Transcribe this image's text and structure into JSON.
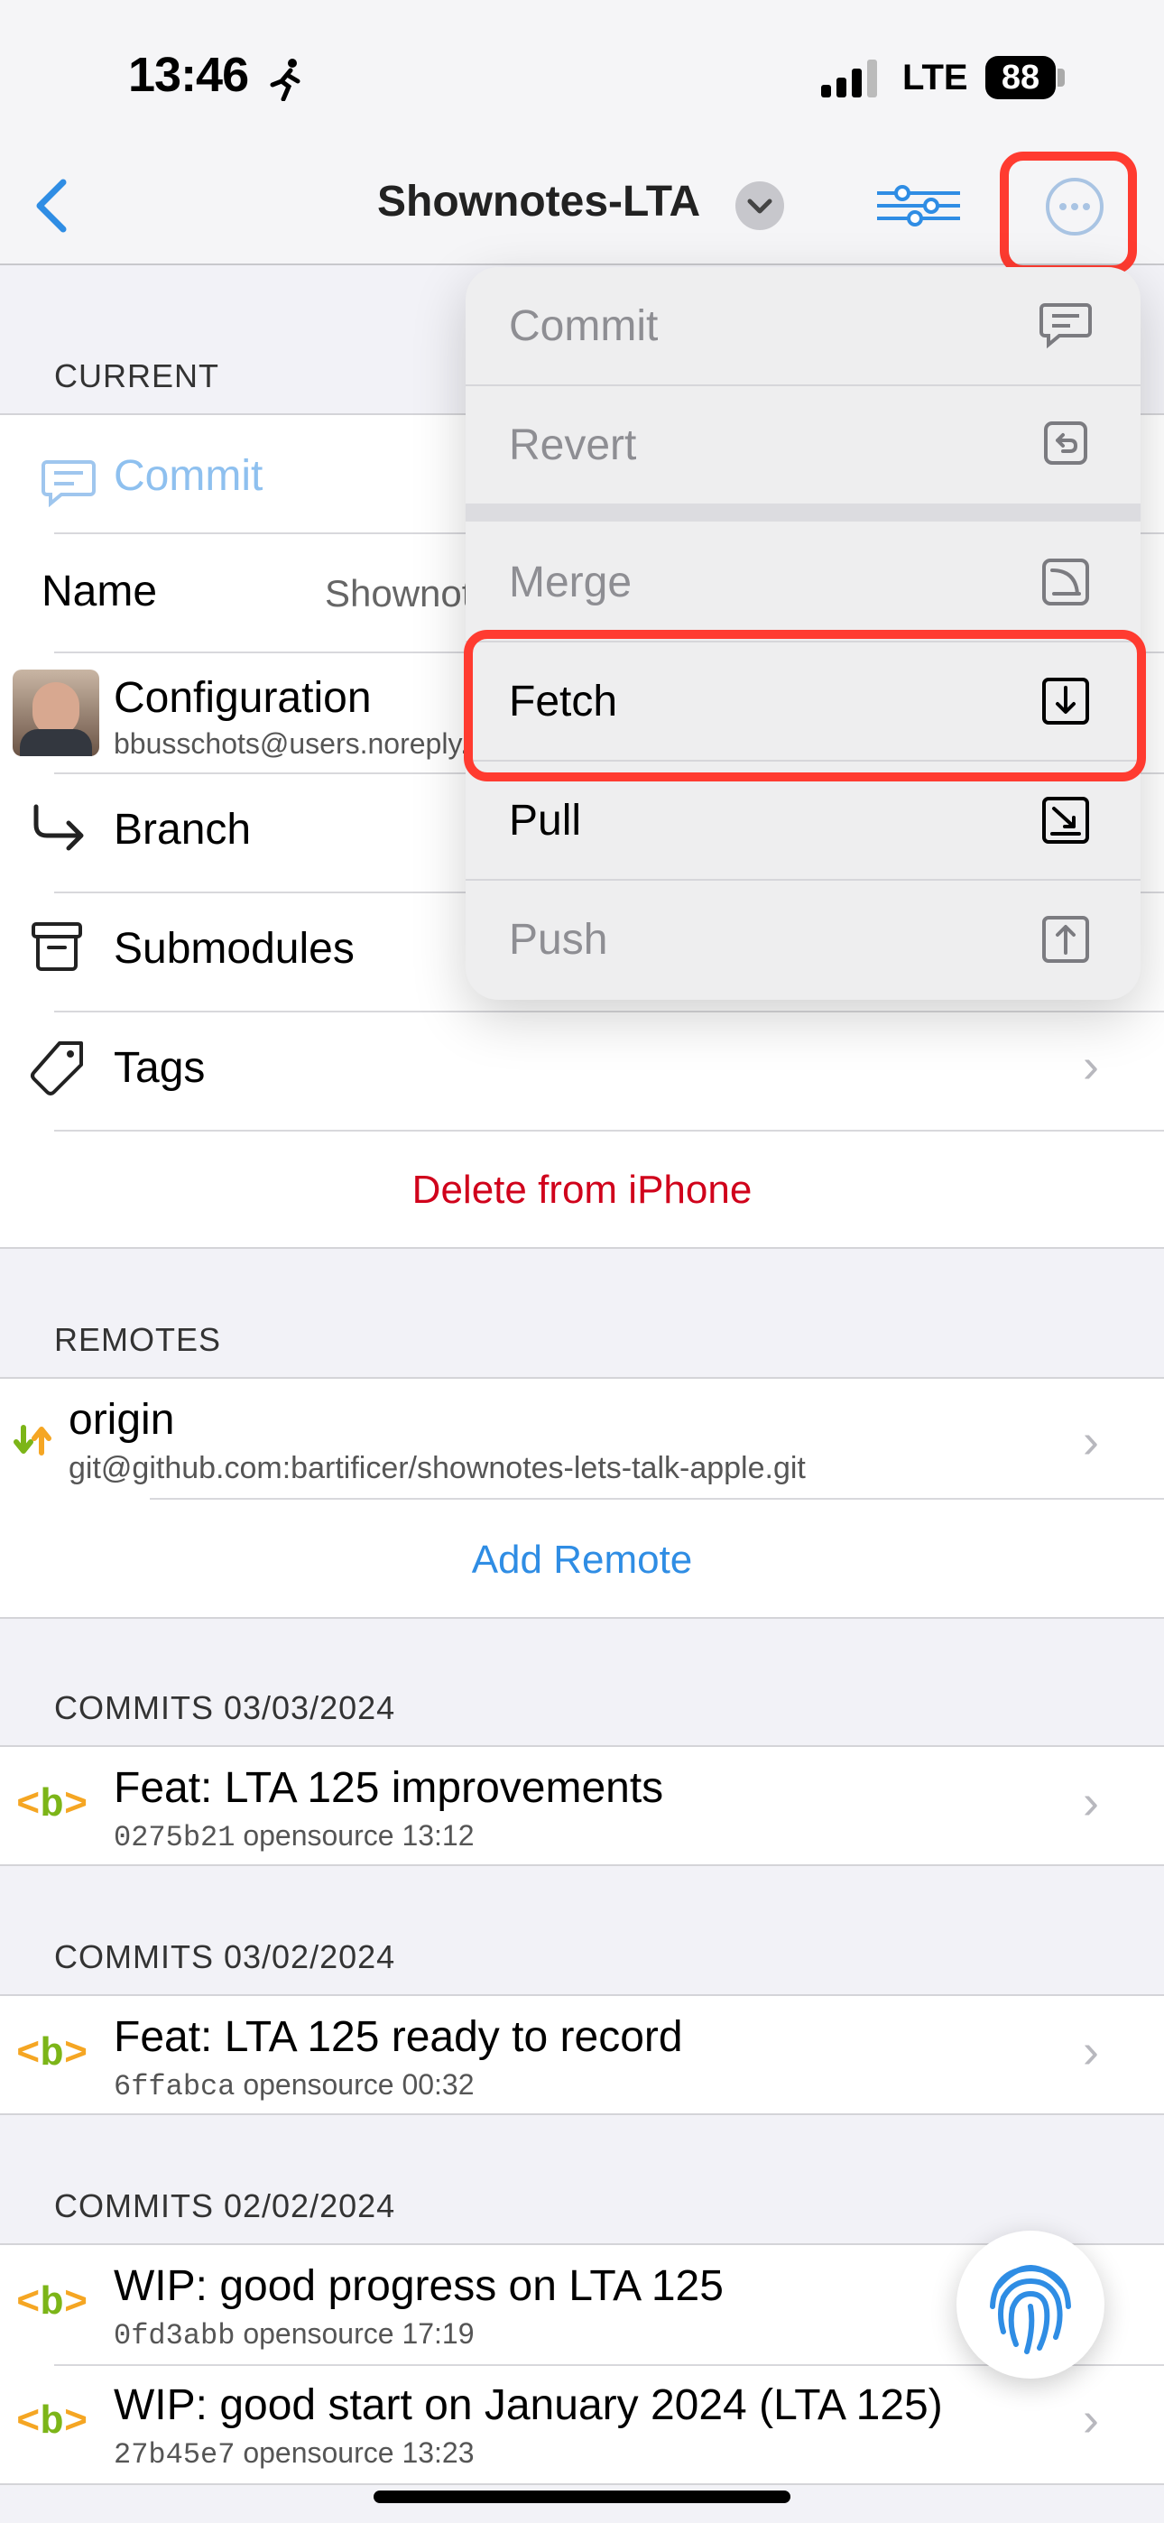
{
  "status_bar": {
    "time": "13:46",
    "network": "LTE",
    "battery": "88"
  },
  "nav": {
    "title": "Shownotes-LTA"
  },
  "current": {
    "header": "CURRENT",
    "commit_label": "Commit",
    "name_label": "Name",
    "name_value": "Shownotes-LTA",
    "config_label": "Configuration",
    "config_email": "bbusschots@users.noreply.github.com",
    "branch_label": "Branch",
    "submodules_label": "Submodules",
    "tags_label": "Tags",
    "delete_label": "Delete from iPhone"
  },
  "menu": {
    "items": [
      {
        "label": "Commit",
        "icon": "commit-bubble-icon",
        "enabled": false
      },
      {
        "label": "Revert",
        "icon": "revert-icon",
        "enabled": false
      },
      {
        "label": "Merge",
        "icon": "merge-icon",
        "enabled": false
      },
      {
        "label": "Fetch",
        "icon": "fetch-icon",
        "enabled": true
      },
      {
        "label": "Pull",
        "icon": "pull-icon",
        "enabled": true
      },
      {
        "label": "Push",
        "icon": "push-icon",
        "enabled": false
      }
    ]
  },
  "remotes": {
    "header": "REMOTES",
    "items": [
      {
        "name": "origin",
        "url": "git@github.com:bartificer/shownotes-lets-talk-apple.git"
      }
    ],
    "add_label": "Add Remote"
  },
  "commit_groups": [
    {
      "header": "COMMITS 03/03/2024",
      "commits": [
        {
          "message": "Feat: LTA 125 improvements",
          "hash": "0275b21",
          "meta": "opensource 13:12"
        }
      ]
    },
    {
      "header": "COMMITS 03/02/2024",
      "commits": [
        {
          "message": "Feat: LTA 125 ready to record",
          "hash": "6ffabca",
          "meta": "opensource 00:32"
        }
      ]
    },
    {
      "header": "COMMITS 02/02/2024",
      "commits": [
        {
          "message": "WIP: good progress on LTA 125",
          "hash": "0fd3abb",
          "meta": "opensource 17:19"
        },
        {
          "message": "WIP: good start on January 2024 (LTA 125)",
          "hash": "27b45e7",
          "meta": "opensource 13:23"
        }
      ]
    }
  ],
  "branch_tag": "<b>",
  "colors": {
    "accent": "#2f8de4",
    "destructive": "#d0021b",
    "highlight": "#ff3b30",
    "tag_orange": "#f5a623",
    "tag_green": "#7cb518"
  }
}
